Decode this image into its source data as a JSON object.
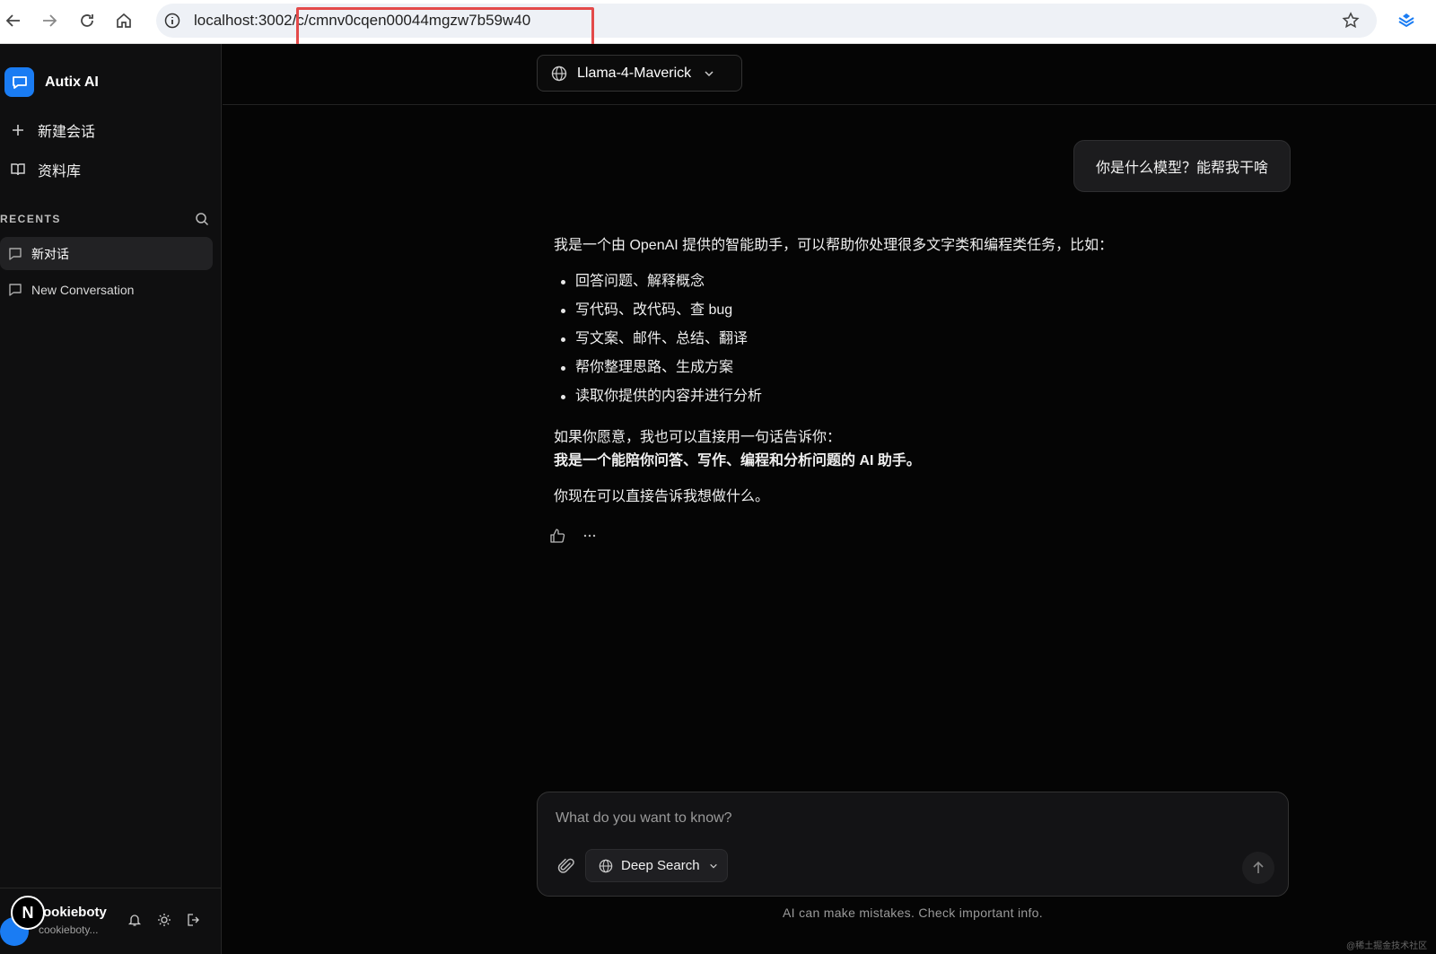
{
  "browser": {
    "url": "localhost:3002/c/cmnv0cqen00044mgzw7b59w40"
  },
  "sidebar": {
    "app_name": "Autix AI",
    "new_chat_label": "新建会话",
    "library_label": "资料库",
    "recents_label": "RECENTS",
    "conversations": [
      {
        "title": "新对话",
        "active": true
      },
      {
        "title": "New Conversation",
        "active": false
      }
    ],
    "user": {
      "initial": "N",
      "name": "ookieboty",
      "email": "cookieboty..."
    }
  },
  "header": {
    "model_name": "Llama-4-Maverick"
  },
  "chat": {
    "user_message": "你是什么模型？能帮我干啥",
    "assistant": {
      "intro": "我是一个由 OpenAI 提供的智能助手，可以帮助你处理很多文字类和编程类任务，比如：",
      "bullets": [
        "回答问题、解释概念",
        "写代码、改代码、查 bug",
        "写文案、邮件、总结、翻译",
        "帮你整理思路、生成方案",
        "读取你提供的内容并进行分析"
      ],
      "summary_line": "如果你愿意，我也可以直接用一句话告诉你：",
      "summary_bold": "我是一个能陪你问答、写作、编程和分析问题的 AI 助手。",
      "closing": "你现在可以直接告诉我想做什么。"
    }
  },
  "composer": {
    "placeholder": "What do you want to know?",
    "deep_search_label": "Deep Search",
    "disclaimer": "AI can make mistakes. Check important info."
  },
  "watermark": "@稀土掘金技术社区",
  "colors": {
    "accent": "#1a7cf3",
    "highlight_box": "#e34a4a",
    "background": "#050505"
  }
}
